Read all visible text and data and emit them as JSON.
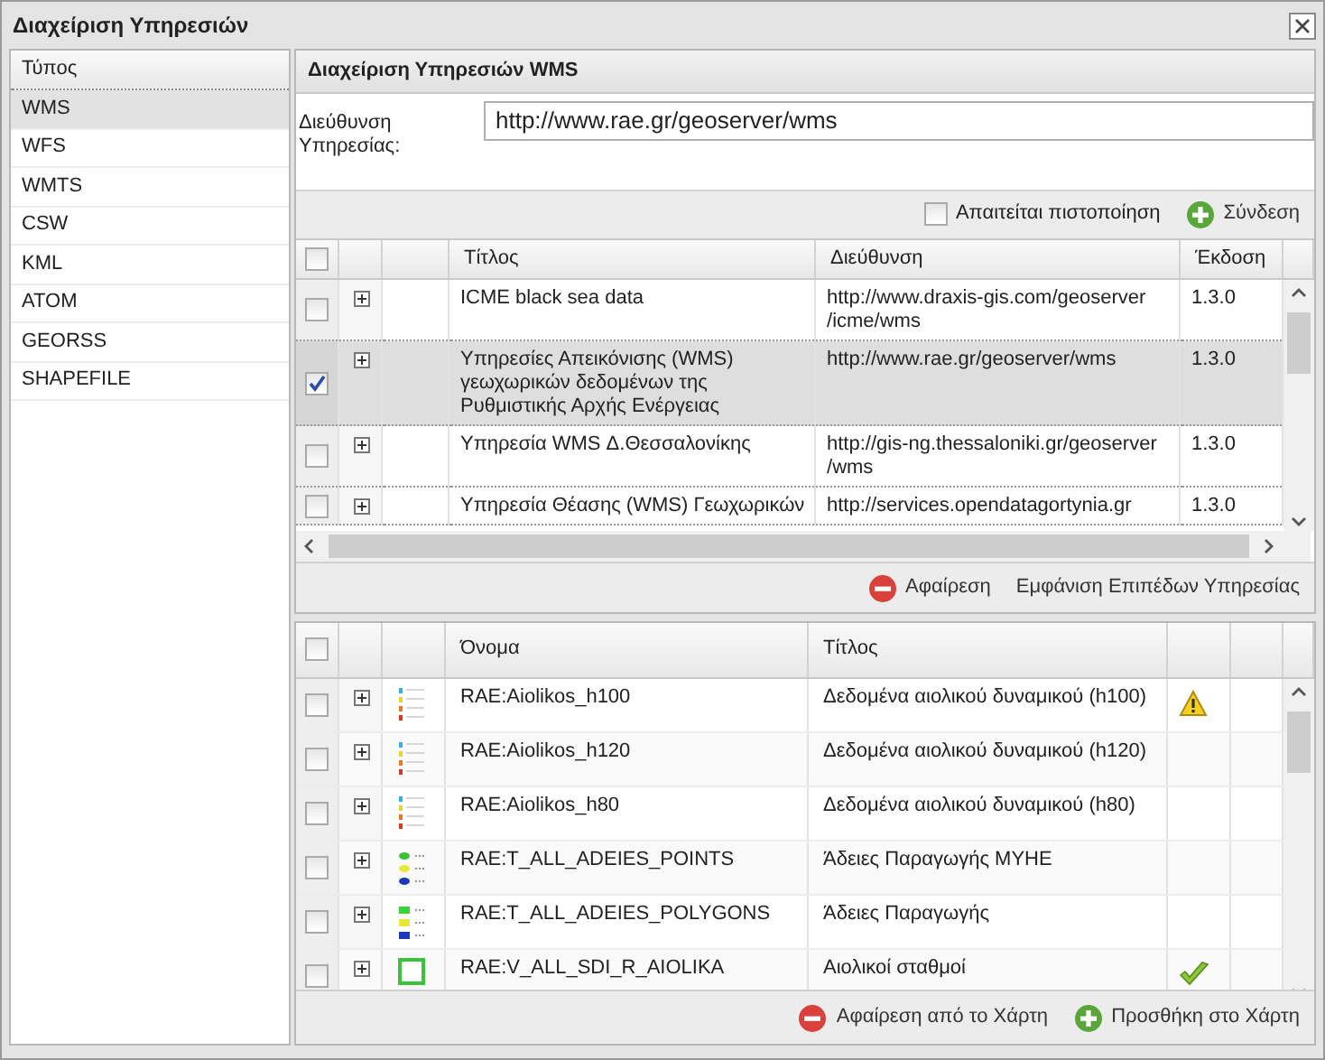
{
  "window": {
    "title": "Διαχείριση Υπηρεσιών"
  },
  "types": {
    "header": "Τύπος",
    "items": [
      {
        "label": "WMS",
        "selected": true
      },
      {
        "label": "WFS",
        "selected": false
      },
      {
        "label": "WMTS",
        "selected": false
      },
      {
        "label": "CSW",
        "selected": false
      },
      {
        "label": "KML",
        "selected": false
      },
      {
        "label": "ATOM",
        "selected": false
      },
      {
        "label": "GEORSS",
        "selected": false
      },
      {
        "label": "SHAPEFILE",
        "selected": false
      }
    ]
  },
  "service_panel": {
    "title": "Διαχείριση Υπηρεσιών WMS",
    "address_label": "Διεύθυνση Υπηρεσίας:",
    "address_value": "http://www.rae.gr/geoserver/wms",
    "auth": {
      "label": "Απαιτείται πιστοποίηση",
      "checked": false
    },
    "connect_button": "Σύνδεση"
  },
  "services": {
    "all_checked": false,
    "columns": [
      "Τίτλος",
      "Διεύθυνση",
      "Έκδοση"
    ],
    "rows": [
      {
        "title": "ICME black sea data",
        "address": "http://www.draxis-gis.com/geoserver/icme/wms",
        "version": "1.3.0",
        "checked": false,
        "selected": false
      },
      {
        "title": "Υπηρεσίες Απεικόνισης (WMS) γεωχωρικών δεδομένων της Ρυθμιστικής Αρχής Ενέργειας",
        "address": "http://www.rae.gr/geoserver/wms",
        "version": "1.3.0",
        "checked": true,
        "selected": true
      },
      {
        "title": "Υπηρεσία WMS Δ.Θεσσαλονίκης",
        "address": "http://gis-ng.thessaloniki.gr/geoserver/wms",
        "version": "1.3.0",
        "checked": false,
        "selected": false
      },
      {
        "title": "Υπηρεσία Θέασης (WMS) Γεωχωρικών",
        "address": "http://services.opendatagortynia.gr",
        "version": "1.3.0",
        "checked": false,
        "selected": false
      }
    ]
  },
  "service_actions": [
    {
      "label": "Αφαίρεση",
      "kind": "remove"
    },
    {
      "label": "Εμφάνιση Επιπέδων Υπηρεσίας",
      "kind": "plain"
    }
  ],
  "layers": {
    "all_checked": false,
    "columns": [
      "Όνομα",
      "Τίτλος"
    ],
    "rows": [
      {
        "name": "RAE:Aiolikos_h100",
        "title": "Δεδομένα αιολικού δυναμικού (h100)",
        "kind": "ramp",
        "warning": true,
        "ok": false,
        "checked": false
      },
      {
        "name": "RAE:Aiolikos_h120",
        "title": "Δεδομένα αιολικού δυναμικού (h120)",
        "kind": "ramp",
        "warning": false,
        "ok": false,
        "checked": false
      },
      {
        "name": "RAE:Aiolikos_h80",
        "title": "Δεδομένα αιολικού δυναμικού (h80)",
        "kind": "ramp",
        "warning": false,
        "ok": false,
        "checked": false
      },
      {
        "name": "RAE:T_ALL_ADEIES_POINTS",
        "title": "Άδειες Παραγωγής ΜΥΗΕ",
        "kind": "points",
        "warning": false,
        "ok": false,
        "checked": false
      },
      {
        "name": "RAE:T_ALL_ADEIES_POLYGONS",
        "title": "Άδειες Παραγωγής",
        "kind": "polygons",
        "warning": false,
        "ok": false,
        "checked": false
      },
      {
        "name": "RAE:V_ALL_SDI_R_AIOLIKA",
        "title": "Αιολικοί σταθμοί",
        "kind": "square",
        "warning": false,
        "ok": true,
        "checked": false
      }
    ]
  },
  "layer_actions": [
    {
      "label": "Αφαίρεση από το Χάρτη",
      "kind": "remove"
    },
    {
      "label": "Προσθήκη στο Χάρτη",
      "kind": "add"
    }
  ]
}
